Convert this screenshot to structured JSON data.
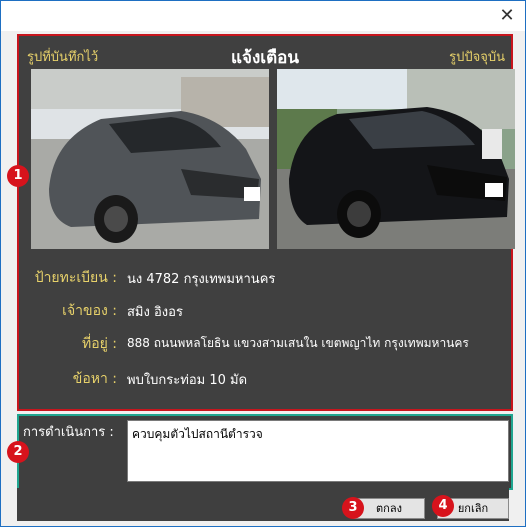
{
  "window": {
    "close_glyph": "✕"
  },
  "alert": {
    "left_header": "รูปที่บันทึกไว้",
    "title": "แจ้งเตือน",
    "right_header": "รูปปัจจุบัน",
    "fields": [
      {
        "label": "ป้ายทะเบียน :",
        "value": "นง 4782 กรุงเทพมหานคร"
      },
      {
        "label": "เจ้าของ :",
        "value": "สมิง อิงอร"
      },
      {
        "label": "ที่อยู่ :",
        "value": "888 ถนนพหลโยธิน แขวงสามเสนใน เขตพญาไท กรุงเทพมหานคร"
      },
      {
        "label": "ข้อหา :",
        "value": "พบใบกระท่อม 10 มัด"
      }
    ]
  },
  "action": {
    "label": "การดำเนินการ :",
    "value": "ควบคุมตัวไปสถานีตำรวจ"
  },
  "buttons": {
    "ok": "ตกลง",
    "cancel": "ยกเลิก"
  },
  "badges": [
    "1",
    "2",
    "3",
    "4"
  ],
  "colors": {
    "alert_border": "#c8151d",
    "action_border": "#1fa58f",
    "label_yellow": "#e7d16a",
    "badge_red": "#d7131c"
  }
}
